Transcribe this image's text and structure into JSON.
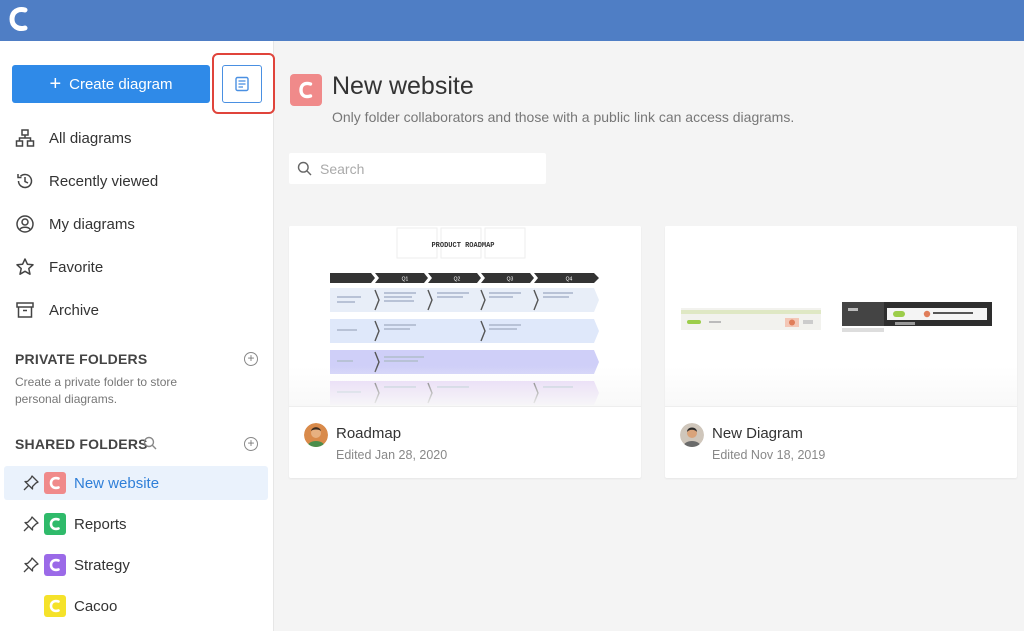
{
  "app": {
    "accent": "#4f7ec5",
    "primary_button": "#2f8ae8"
  },
  "sidebar": {
    "create_label": "Create diagram",
    "nav": [
      {
        "label": "All diagrams",
        "icon": "sitemap-icon"
      },
      {
        "label": "Recently viewed",
        "icon": "history-icon"
      },
      {
        "label": "My diagrams",
        "icon": "user-circle-icon"
      },
      {
        "label": "Favorite",
        "icon": "star-icon"
      },
      {
        "label": "Archive",
        "icon": "archive-icon"
      }
    ],
    "private_folders": {
      "title": "PRIVATE FOLDERS",
      "description": "Create a private folder to store personal diagrams."
    },
    "shared_folders": {
      "title": "SHARED FOLDERS",
      "items": [
        {
          "label": "New website",
          "color": "#f08a8a",
          "pinned": true,
          "active": true
        },
        {
          "label": "Reports",
          "color": "#2fba6a",
          "pinned": true,
          "active": false
        },
        {
          "label": "Strategy",
          "color": "#9b6ae8",
          "pinned": true,
          "active": false
        },
        {
          "label": "Cacoo",
          "color": "#f5e22a",
          "pinned": false,
          "active": false
        }
      ]
    }
  },
  "main": {
    "title": "New website",
    "subtitle": "Only folder collaborators and those with a public link can access diagrams.",
    "search_placeholder": "Search",
    "cards": [
      {
        "name": "Roadmap",
        "edited": "Edited Jan 28, 2020",
        "thumb_title": "PRODUCT ROADMAP",
        "thumb_columns": [
          "Q1",
          "Q2",
          "Q3",
          "Q4"
        ]
      },
      {
        "name": "New Diagram",
        "edited": "Edited Nov 18, 2019"
      }
    ]
  }
}
